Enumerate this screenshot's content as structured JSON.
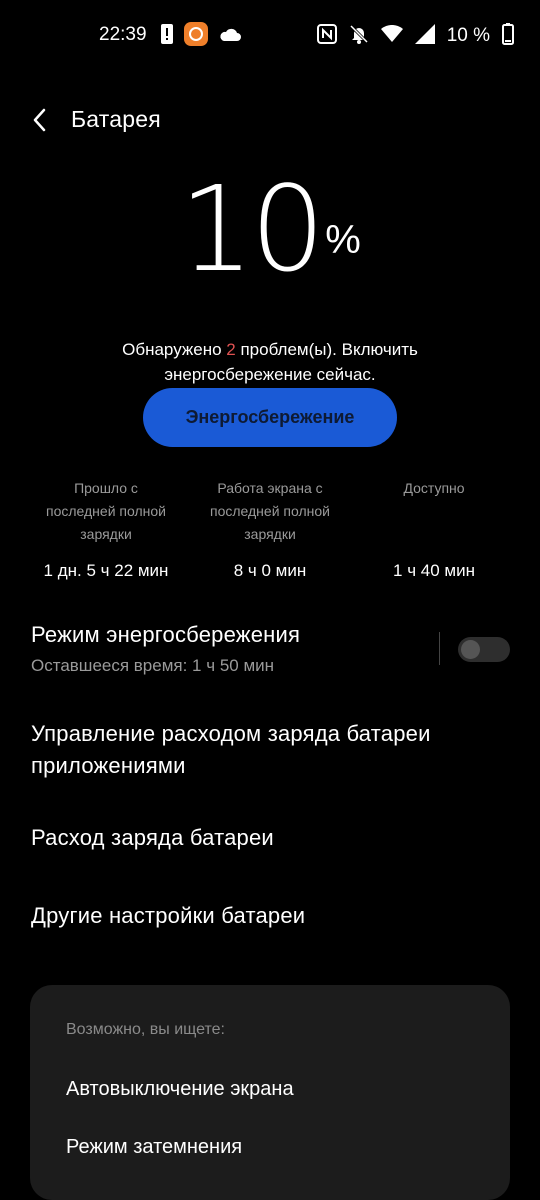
{
  "status": {
    "time": "22:39",
    "battery_pct": "10 %",
    "icons_left": [
      "alert-icon",
      "app-notification-icon",
      "cloud-icon"
    ],
    "icons_right": [
      "nfc-icon",
      "bell-off-icon",
      "wifi-icon",
      "signal-icon",
      "battery-icon"
    ]
  },
  "header": {
    "title": "Батарея"
  },
  "battery": {
    "percent": "10",
    "unit": "%"
  },
  "problems": {
    "prefix": "Обнаружено ",
    "count": "2",
    "suffix_line1": " проблем(ы). Включить",
    "line2": "энергосбережение сейчас."
  },
  "saver_button": {
    "label": "Энергосбережение",
    "color": "#1a5ad6"
  },
  "stats": [
    {
      "label": "Прошло с последней полной зарядки",
      "value": "1 дн. 5 ч 22 мин"
    },
    {
      "label": "Работа экрана с последней полной зарядки",
      "value": "8 ч 0 мин"
    },
    {
      "label": "Доступно",
      "value": "1 ч 40 мин"
    }
  ],
  "power_saving": {
    "title": "Режим энергосбережения",
    "remaining": "Оставшееся время:  1 ч 50 мин",
    "enabled": false
  },
  "menu": {
    "app_management": "Управление расходом заряда батареи приложениями",
    "usage": "Расход заряда батареи",
    "other": "Другие настройки батареи"
  },
  "suggestions": {
    "heading": "Возможно, вы ищете:",
    "items": [
      "Автовыключение экрана",
      "Режим затемнения"
    ]
  }
}
